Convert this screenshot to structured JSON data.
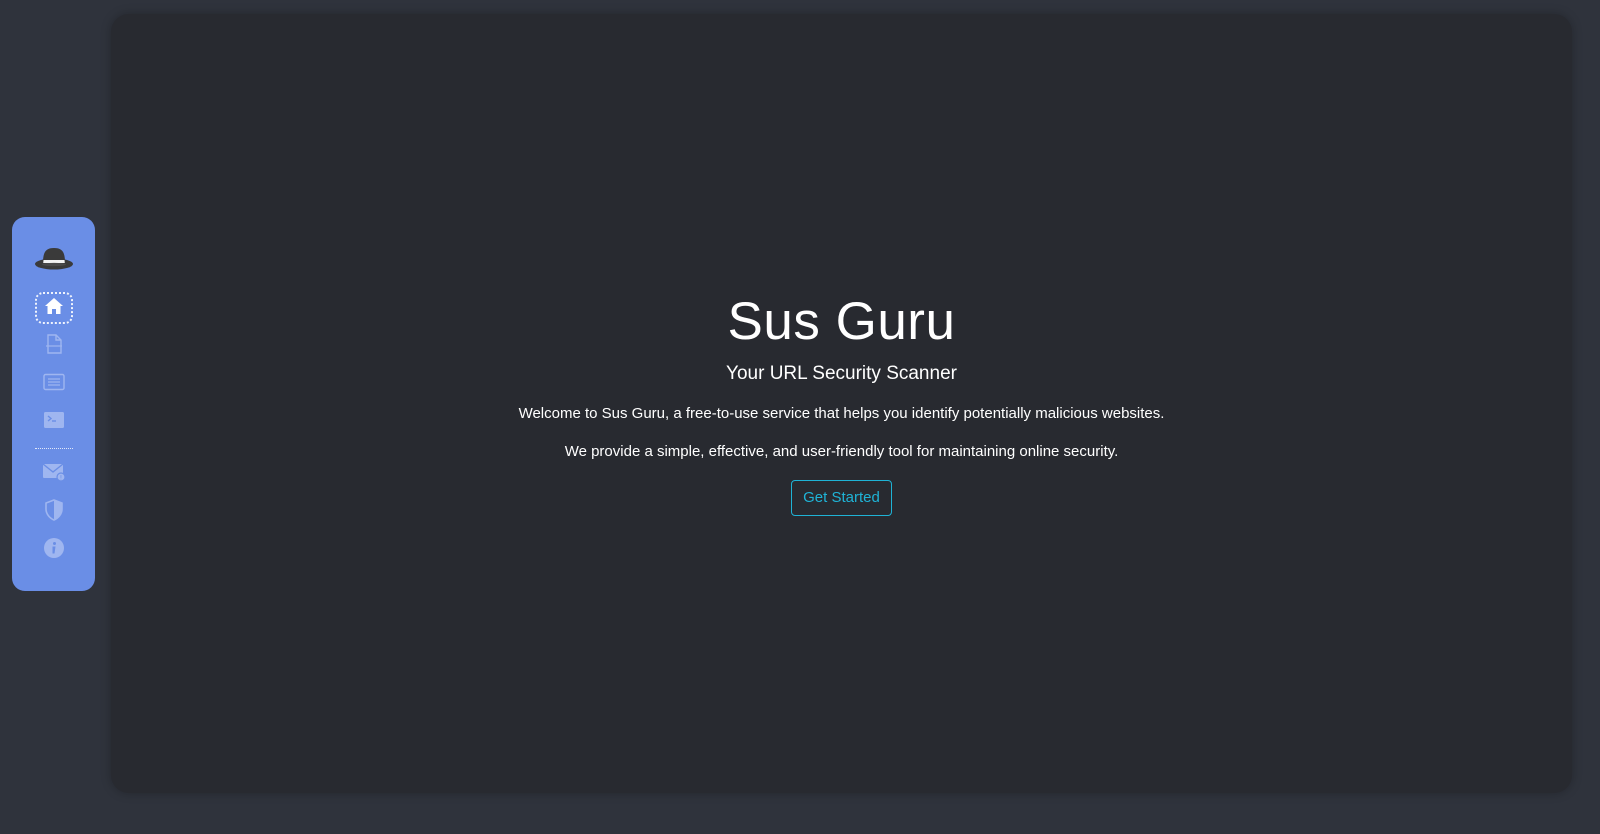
{
  "app": {
    "title": "Sus Guru"
  },
  "sidebar": {
    "logo_icon": "hat-icon",
    "items": [
      {
        "id": "home",
        "icon": "home-icon",
        "active": true
      },
      {
        "id": "report",
        "icon": "document-icon",
        "active": false
      },
      {
        "id": "list",
        "icon": "list-icon",
        "active": false
      },
      {
        "id": "terminal",
        "icon": "terminal-icon",
        "active": false
      },
      {
        "id": "mail",
        "icon": "mail-icon",
        "active": false
      },
      {
        "id": "security",
        "icon": "shield-icon",
        "active": false
      },
      {
        "id": "about",
        "icon": "info-icon",
        "active": false
      }
    ]
  },
  "hero": {
    "title": "Sus Guru",
    "subtitle": "Your URL Security Scanner",
    "paragraph_1": "Welcome to Sus Guru, a free-to-use service that helps you identify potentially malicious websites.",
    "paragraph_2": "We provide a simple, effective, and user-friendly tool for maintaining online security.",
    "cta_label": "Get Started"
  },
  "colors": {
    "page_background": "#2f333c",
    "panel_background": "#282a30",
    "sidebar_background": "#6a8ee6",
    "accent": "#1fb3d6",
    "text": "#ffffff"
  }
}
